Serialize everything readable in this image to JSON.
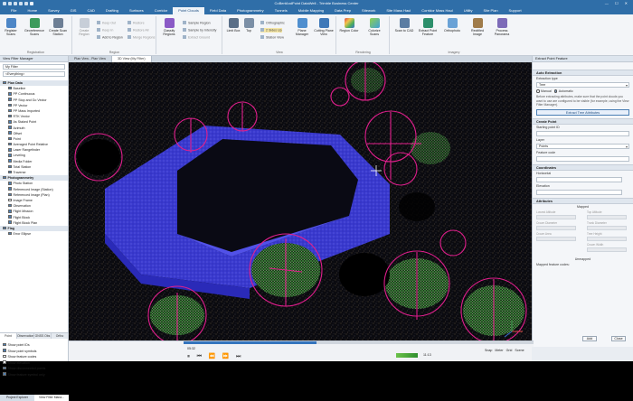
{
  "window": {
    "title": "CoBertAndPoint DataWell - Trimble Business Center",
    "colors": {
      "accent": "#2f6ea8",
      "cloud_blue": "#3b3bd8",
      "marker_magenta": "#e01e8c",
      "vegetation_green": "#3fa84a"
    }
  },
  "menu": [
    {
      "label": "File",
      "active": false
    },
    {
      "label": "Home",
      "active": false
    },
    {
      "label": "Survey",
      "active": false
    },
    {
      "label": "GIS",
      "active": false
    },
    {
      "label": "CAD",
      "active": false
    },
    {
      "label": "Drafting",
      "active": false
    },
    {
      "label": "Surfaces",
      "active": false
    },
    {
      "label": "Corridor",
      "active": false
    },
    {
      "label": "Point Clouds",
      "active": true
    },
    {
      "label": "Field Data",
      "active": false
    },
    {
      "label": "Photogrammetry",
      "active": false
    },
    {
      "label": "Tunnels",
      "active": false
    },
    {
      "label": "Mobile Mapping",
      "active": false
    },
    {
      "label": "Data Prep",
      "active": false
    },
    {
      "label": "Sitework",
      "active": false
    },
    {
      "label": "Site Mass Haul",
      "active": false
    },
    {
      "label": "Corridor Mass Haul",
      "active": false
    },
    {
      "label": "Utility",
      "active": false
    },
    {
      "label": "Site Plan",
      "active": false
    },
    {
      "label": "Support",
      "active": false
    }
  ],
  "ribbon": {
    "registration": {
      "label": "Registration",
      "buttons": [
        "Register Scans",
        "Georeference Scans",
        "Create Scan Station"
      ]
    },
    "region": {
      "label": "Region",
      "buttons": [
        "Create Region"
      ],
      "small": [
        "Keep Out",
        "Keep In",
        "Add to Region",
        "Restore",
        "Restore All",
        "Merge Regions"
      ]
    },
    "classify": {
      "buttons": [
        "Classify Regions"
      ],
      "small": [
        "Sample Region",
        "Sample by Intensity",
        "Extract Ground"
      ]
    },
    "view": {
      "label": "View",
      "buttons": [
        "Limit Box",
        "Top",
        "Plane Manager",
        "Cutting Plane View"
      ],
      "small": [
        "Orthographic",
        "2 Sides Up",
        "Station View"
      ]
    },
    "rendering": {
      "label": "Rendering",
      "buttons": [
        "Region Color",
        "Colorize Scans"
      ]
    },
    "imagery": {
      "label": "Imagery",
      "buttons": [
        "Scan to CAD",
        "Extract Point Feature",
        "Orthophoto",
        "Rectified Image",
        "Process Panorama"
      ]
    }
  },
  "left_panel": {
    "title": "View Filter Manager",
    "filter_name": "My Filter",
    "filter_scope": "<Everything>",
    "tree": [
      {
        "label": "Plan Data",
        "group": true
      },
      {
        "label": "Baseline",
        "checked": true
      },
      {
        "label": "PP Continuous",
        "checked": true
      },
      {
        "label": "PP Stop and Go Vector",
        "checked": true
      },
      {
        "label": "PP Vector",
        "checked": true
      },
      {
        "label": "PP Mass Imported",
        "checked": true
      },
      {
        "label": "RTK Vector",
        "checked": true
      },
      {
        "label": "As Staked Point",
        "checked": true
      },
      {
        "label": "Azimuth",
        "checked": true
      },
      {
        "label": "Offset",
        "checked": true
      },
      {
        "label": "Point",
        "checked": true
      },
      {
        "label": "Averaged Point Relative",
        "checked": true
      },
      {
        "label": "Laser Rangefinder",
        "checked": true
      },
      {
        "label": "Leveling",
        "checked": true
      },
      {
        "label": "Media Folder",
        "checked": true
      },
      {
        "label": "Total Station",
        "checked": true
      },
      {
        "label": "Traverse",
        "checked": true
      },
      {
        "label": "Photogrammetry",
        "group": true
      },
      {
        "label": "Photo Station",
        "checked": true
      },
      {
        "label": "Referenced Image (Station)",
        "checked": true
      },
      {
        "label": "Referenced Image (Plan)",
        "checked": true
      },
      {
        "label": "Image Frame",
        "checked": false
      },
      {
        "label": "Observation",
        "checked": true
      },
      {
        "label": "Flight Mission",
        "checked": true
      },
      {
        "label": "Flight Block",
        "checked": true
      },
      {
        "label": "Flight Block Plan",
        "checked": true
      },
      {
        "label": "Flag",
        "group": true
      },
      {
        "label": "Error Ellipse",
        "checked": true
      }
    ],
    "tabs": [
      "Point",
      "Observations",
      "GNSS Obs",
      "Ortho"
    ],
    "options": [
      {
        "label": "Show point IDs",
        "checked": true
      },
      {
        "label": "Show point symbols",
        "checked": true
      },
      {
        "label": "Show feature codes",
        "checked": false
      },
      {
        "label": "Show elevation",
        "checked": false
      },
      {
        "label": "Show disconnected points",
        "checked": true
      },
      {
        "label": "Show feature symbol only",
        "checked": true
      }
    ],
    "bottom_tabs": [
      "Project Explorer",
      "View Filter Mana..."
    ]
  },
  "doc_tabs": [
    {
      "label": "Plan View - Plan View",
      "active": false
    },
    {
      "label": "3D View (My Filter)",
      "active": true
    }
  ],
  "right_panel": {
    "title": "Extract Point Feature",
    "detection": {
      "section": "Auto Extraction",
      "type_label": "Extraction type",
      "type_value": "Tree",
      "mode_manual": "Manual",
      "mode_auto": "Automatic",
      "help": "Before extracting attributes, make sure that the point clouds you want to use are configured to be visible (for example, using the View Filter Manager).",
      "button": "Extract Tree Attributes"
    },
    "create_point": {
      "section": "Create Point",
      "start_id_label": "Starting point ID",
      "start_id_value": "",
      "layer_label": "Layer",
      "layer_value": "Points",
      "code_label": "Feature code"
    },
    "coordinates": {
      "section": "Coordinates",
      "horizontal_label": "Horizontal",
      "elevation_label": "Elevation"
    },
    "attributes": {
      "section": "Attributes",
      "mapped_label": "Mapped",
      "unmapped_label": "Unmapped",
      "fields": [
        "Lowest Altitude",
        "Top Altitude",
        "Crown Diameter",
        "Trunk Diameter",
        "Crown Area",
        "Tree Height",
        "Crown Width"
      ],
      "mapped_codes_label": "Mapped feature codes:"
    }
  },
  "statusbar": {
    "add_label": "Add",
    "close_label": "Close",
    "right_items": [
      "Snap",
      "Meter",
      "Grid",
      "Scene"
    ]
  },
  "media": {
    "progress": 0.38,
    "time_left": "05:32",
    "time_total": "11:13"
  }
}
